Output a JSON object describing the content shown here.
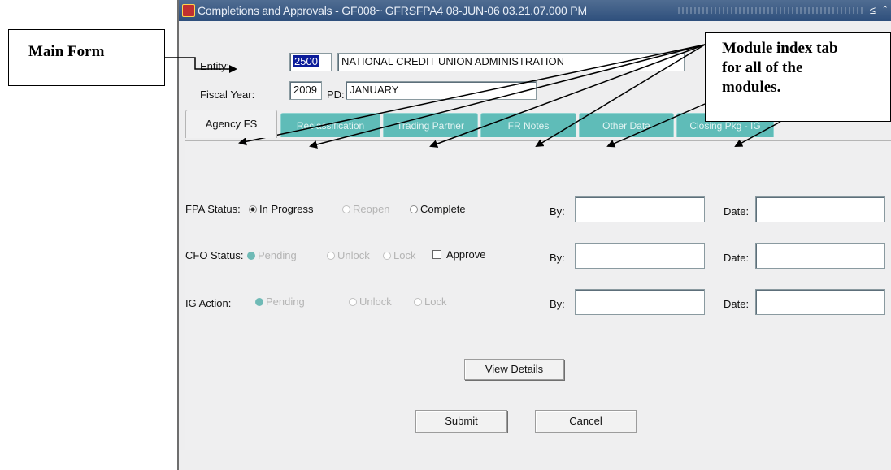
{
  "window": {
    "title": "Completions and Approvals - GF008~ GFRSFPA4  08-JUN-06 03.21.07.000 PM",
    "controls": "≤ ˆ"
  },
  "annotations": {
    "main_form": "Main Form",
    "module_index": [
      "Module index tab",
      "for all of the",
      "modules."
    ]
  },
  "header": {
    "entity_label": "Entity:",
    "entity_code": "2500",
    "entity_name": "NATIONAL CREDIT UNION ADMINISTRATION",
    "fiscal_year_label": "Fiscal Year:",
    "fiscal_year": "2009",
    "pd_label": "PD:",
    "pd_value": "JANUARY"
  },
  "tabs": [
    {
      "label": "Agency FS",
      "active": true
    },
    {
      "label": "Reclassification",
      "active": false
    },
    {
      "label": "Trading Partner",
      "active": false
    },
    {
      "label": "FR Notes",
      "active": false
    },
    {
      "label": "Other Data",
      "active": false
    },
    {
      "label": "Closing Pkg - IG",
      "active": false
    }
  ],
  "status": {
    "fpa_label": "FPA Status:",
    "fpa_options": [
      "In Progress",
      "Reopen",
      "Complete"
    ],
    "fpa_selected": "In Progress",
    "cfo_label": "CFO Status:",
    "cfo_options": [
      "Pending",
      "Unlock",
      "Lock"
    ],
    "cfo_approve_label": "Approve",
    "ig_label": "IG Action:",
    "ig_options": [
      "Pending",
      "Unlock",
      "Lock"
    ],
    "by_label": "By:",
    "date_label": "Date:"
  },
  "buttons": {
    "view_details": "View Details",
    "submit": "Submit",
    "cancel": "Cancel"
  },
  "colors": {
    "titlebar": "#2e4f7c",
    "inactive_tab": "#5fbcb8",
    "selection": "#0b1c9a"
  }
}
